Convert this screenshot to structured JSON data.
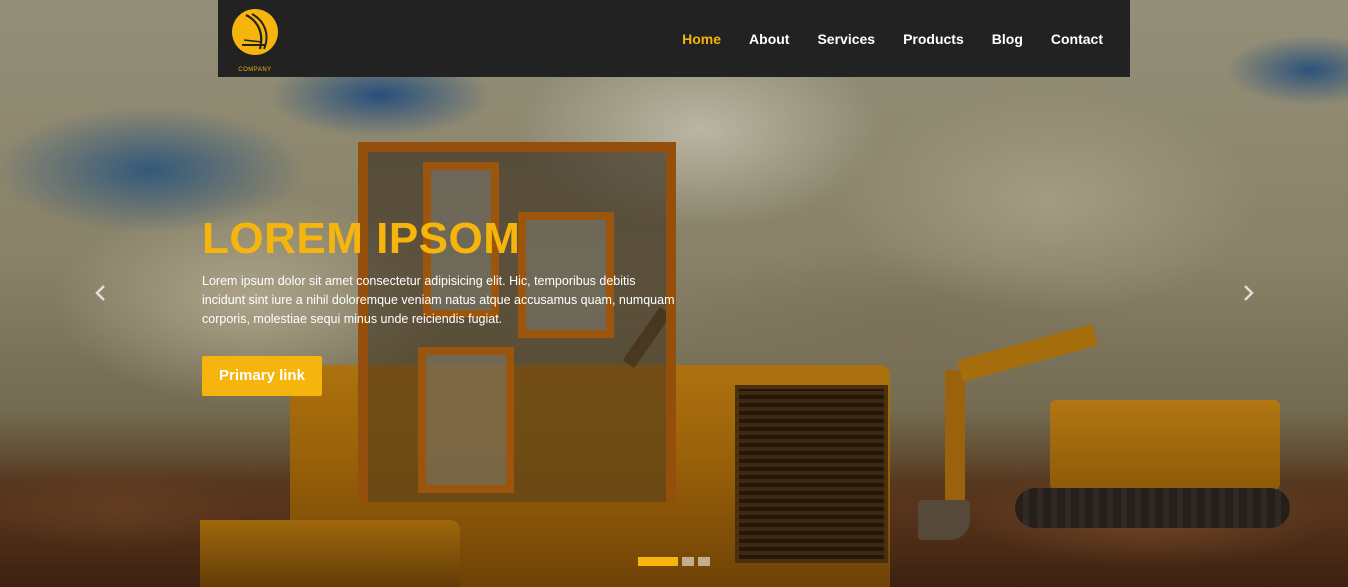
{
  "brand": {
    "logo_text": "COMPANY",
    "accent_color": "#f5b50c",
    "header_bg": "#222222"
  },
  "nav": {
    "items": [
      {
        "label": "Home",
        "active": true
      },
      {
        "label": "About",
        "active": false
      },
      {
        "label": "Services",
        "active": false
      },
      {
        "label": "Products",
        "active": false
      },
      {
        "label": "Blog",
        "active": false
      },
      {
        "label": "Contact",
        "active": false
      }
    ]
  },
  "hero": {
    "title": "LOREM IPSOM",
    "body": "Lorem ipsum dolor sit amet consectetur adipisicing elit. Hic, temporibus debitis incidunt sint iure a nihil doloremque veniam natus atque accusamus quam, numquam corporis, molestiae sequi minus unde reiciendis fugiat.",
    "primary_button": "Primary link",
    "prev_icon": "chevron-left-icon",
    "next_icon": "chevron-right-icon"
  },
  "carousel": {
    "slide_count": 3,
    "active_index": 0
  }
}
